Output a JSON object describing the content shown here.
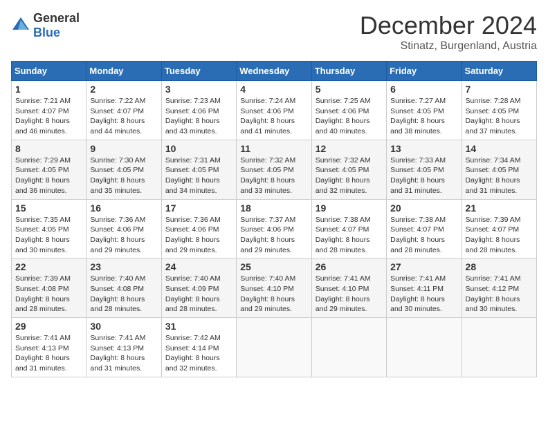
{
  "header": {
    "logo_general": "General",
    "logo_blue": "Blue",
    "title": "December 2024",
    "location": "Stinatz, Burgenland, Austria"
  },
  "days_of_week": [
    "Sunday",
    "Monday",
    "Tuesday",
    "Wednesday",
    "Thursday",
    "Friday",
    "Saturday"
  ],
  "weeks": [
    [
      {
        "day": 1,
        "lines": [
          "Sunrise: 7:21 AM",
          "Sunset: 4:07 PM",
          "Daylight: 8 hours",
          "and 46 minutes."
        ]
      },
      {
        "day": 2,
        "lines": [
          "Sunrise: 7:22 AM",
          "Sunset: 4:07 PM",
          "Daylight: 8 hours",
          "and 44 minutes."
        ]
      },
      {
        "day": 3,
        "lines": [
          "Sunrise: 7:23 AM",
          "Sunset: 4:06 PM",
          "Daylight: 8 hours",
          "and 43 minutes."
        ]
      },
      {
        "day": 4,
        "lines": [
          "Sunrise: 7:24 AM",
          "Sunset: 4:06 PM",
          "Daylight: 8 hours",
          "and 41 minutes."
        ]
      },
      {
        "day": 5,
        "lines": [
          "Sunrise: 7:25 AM",
          "Sunset: 4:06 PM",
          "Daylight: 8 hours",
          "and 40 minutes."
        ]
      },
      {
        "day": 6,
        "lines": [
          "Sunrise: 7:27 AM",
          "Sunset: 4:05 PM",
          "Daylight: 8 hours",
          "and 38 minutes."
        ]
      },
      {
        "day": 7,
        "lines": [
          "Sunrise: 7:28 AM",
          "Sunset: 4:05 PM",
          "Daylight: 8 hours",
          "and 37 minutes."
        ]
      }
    ],
    [
      {
        "day": 8,
        "lines": [
          "Sunrise: 7:29 AM",
          "Sunset: 4:05 PM",
          "Daylight: 8 hours",
          "and 36 minutes."
        ]
      },
      {
        "day": 9,
        "lines": [
          "Sunrise: 7:30 AM",
          "Sunset: 4:05 PM",
          "Daylight: 8 hours",
          "and 35 minutes."
        ]
      },
      {
        "day": 10,
        "lines": [
          "Sunrise: 7:31 AM",
          "Sunset: 4:05 PM",
          "Daylight: 8 hours",
          "and 34 minutes."
        ]
      },
      {
        "day": 11,
        "lines": [
          "Sunrise: 7:32 AM",
          "Sunset: 4:05 PM",
          "Daylight: 8 hours",
          "and 33 minutes."
        ]
      },
      {
        "day": 12,
        "lines": [
          "Sunrise: 7:32 AM",
          "Sunset: 4:05 PM",
          "Daylight: 8 hours",
          "and 32 minutes."
        ]
      },
      {
        "day": 13,
        "lines": [
          "Sunrise: 7:33 AM",
          "Sunset: 4:05 PM",
          "Daylight: 8 hours",
          "and 31 minutes."
        ]
      },
      {
        "day": 14,
        "lines": [
          "Sunrise: 7:34 AM",
          "Sunset: 4:05 PM",
          "Daylight: 8 hours",
          "and 31 minutes."
        ]
      }
    ],
    [
      {
        "day": 15,
        "lines": [
          "Sunrise: 7:35 AM",
          "Sunset: 4:05 PM",
          "Daylight: 8 hours",
          "and 30 minutes."
        ]
      },
      {
        "day": 16,
        "lines": [
          "Sunrise: 7:36 AM",
          "Sunset: 4:06 PM",
          "Daylight: 8 hours",
          "and 29 minutes."
        ]
      },
      {
        "day": 17,
        "lines": [
          "Sunrise: 7:36 AM",
          "Sunset: 4:06 PM",
          "Daylight: 8 hours",
          "and 29 minutes."
        ]
      },
      {
        "day": 18,
        "lines": [
          "Sunrise: 7:37 AM",
          "Sunset: 4:06 PM",
          "Daylight: 8 hours",
          "and 29 minutes."
        ]
      },
      {
        "day": 19,
        "lines": [
          "Sunrise: 7:38 AM",
          "Sunset: 4:07 PM",
          "Daylight: 8 hours",
          "and 28 minutes."
        ]
      },
      {
        "day": 20,
        "lines": [
          "Sunrise: 7:38 AM",
          "Sunset: 4:07 PM",
          "Daylight: 8 hours",
          "and 28 minutes."
        ]
      },
      {
        "day": 21,
        "lines": [
          "Sunrise: 7:39 AM",
          "Sunset: 4:07 PM",
          "Daylight: 8 hours",
          "and 28 minutes."
        ]
      }
    ],
    [
      {
        "day": 22,
        "lines": [
          "Sunrise: 7:39 AM",
          "Sunset: 4:08 PM",
          "Daylight: 8 hours",
          "and 28 minutes."
        ]
      },
      {
        "day": 23,
        "lines": [
          "Sunrise: 7:40 AM",
          "Sunset: 4:08 PM",
          "Daylight: 8 hours",
          "and 28 minutes."
        ]
      },
      {
        "day": 24,
        "lines": [
          "Sunrise: 7:40 AM",
          "Sunset: 4:09 PM",
          "Daylight: 8 hours",
          "and 28 minutes."
        ]
      },
      {
        "day": 25,
        "lines": [
          "Sunrise: 7:40 AM",
          "Sunset: 4:10 PM",
          "Daylight: 8 hours",
          "and 29 minutes."
        ]
      },
      {
        "day": 26,
        "lines": [
          "Sunrise: 7:41 AM",
          "Sunset: 4:10 PM",
          "Daylight: 8 hours",
          "and 29 minutes."
        ]
      },
      {
        "day": 27,
        "lines": [
          "Sunrise: 7:41 AM",
          "Sunset: 4:11 PM",
          "Daylight: 8 hours",
          "and 30 minutes."
        ]
      },
      {
        "day": 28,
        "lines": [
          "Sunrise: 7:41 AM",
          "Sunset: 4:12 PM",
          "Daylight: 8 hours",
          "and 30 minutes."
        ]
      }
    ],
    [
      {
        "day": 29,
        "lines": [
          "Sunrise: 7:41 AM",
          "Sunset: 4:13 PM",
          "Daylight: 8 hours",
          "and 31 minutes."
        ]
      },
      {
        "day": 30,
        "lines": [
          "Sunrise: 7:41 AM",
          "Sunset: 4:13 PM",
          "Daylight: 8 hours",
          "and 31 minutes."
        ]
      },
      {
        "day": 31,
        "lines": [
          "Sunrise: 7:42 AM",
          "Sunset: 4:14 PM",
          "Daylight: 8 hours",
          "and 32 minutes."
        ]
      },
      null,
      null,
      null,
      null
    ]
  ]
}
